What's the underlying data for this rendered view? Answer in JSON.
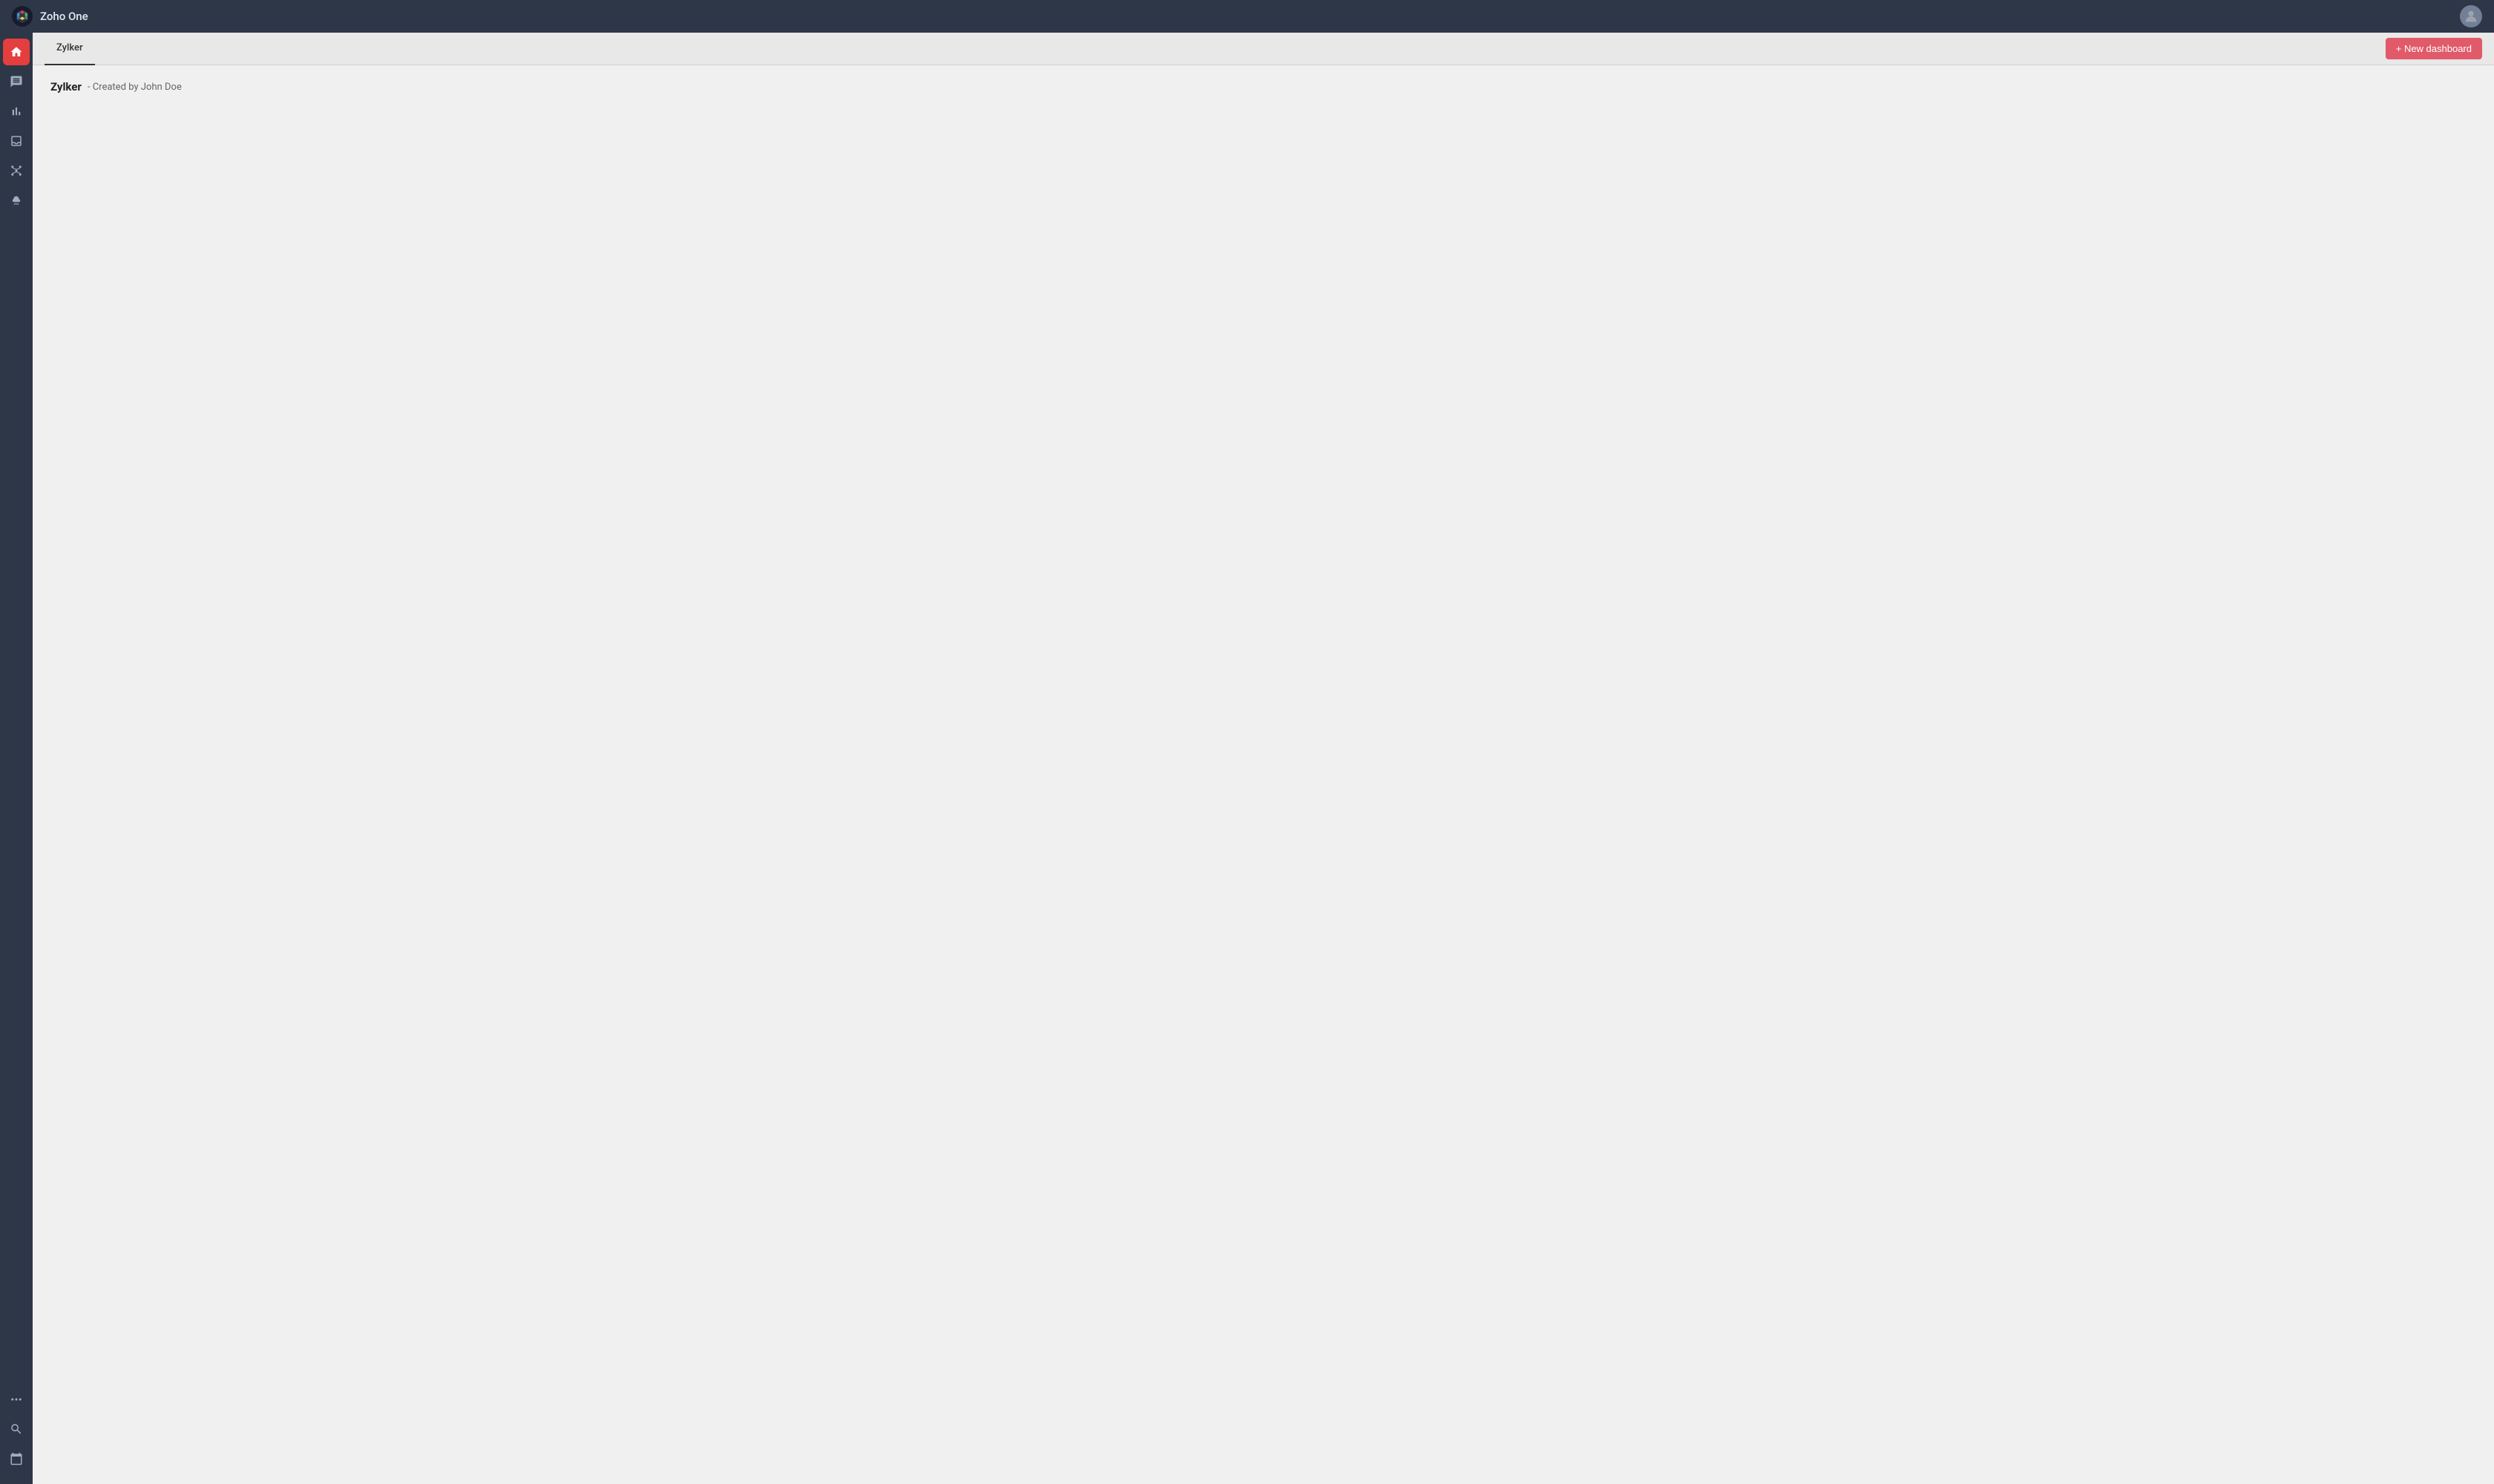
{
  "app": {
    "title": "Zoho One"
  },
  "header": {
    "tab_label": "Zylker",
    "new_dashboard_label": "+ New dashboard"
  },
  "page": {
    "title": "Zylker",
    "subtitle": "- Created by John Doe"
  },
  "sidebar": {
    "items": [
      {
        "name": "home",
        "icon": "home",
        "active": true
      },
      {
        "name": "chat",
        "icon": "chat",
        "active": false
      },
      {
        "name": "analytics",
        "icon": "analytics",
        "active": false
      },
      {
        "name": "inbox",
        "icon": "inbox",
        "active": false
      },
      {
        "name": "integrations",
        "icon": "integrations",
        "active": false
      },
      {
        "name": "cloud",
        "icon": "cloud",
        "active": false
      }
    ],
    "bottom_items": [
      {
        "name": "search",
        "icon": "search"
      },
      {
        "name": "calendar",
        "icon": "calendar"
      },
      {
        "name": "more",
        "icon": "more"
      }
    ]
  }
}
